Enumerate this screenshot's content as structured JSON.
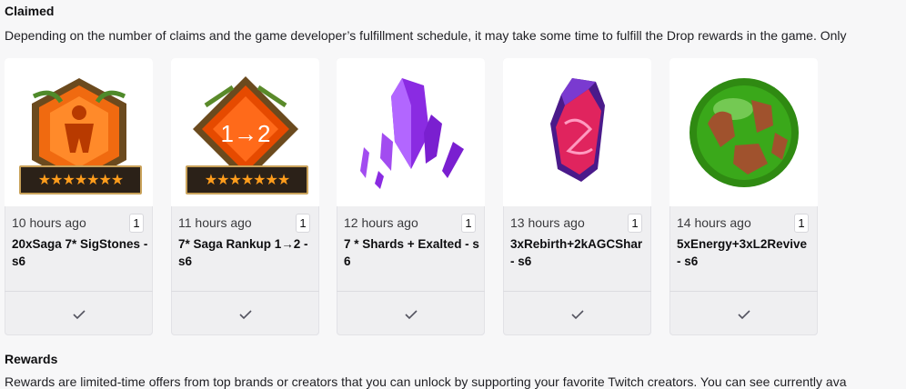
{
  "claimed": {
    "title": "Claimed",
    "description": "Depending on the number of claims and the game developer’s fulfillment schedule, it may take some time to fulfill the Drop rewards in the game. Only"
  },
  "cards": [
    {
      "time": "10 hours ago",
      "count": "1",
      "name": "20xSaga 7* SigStones - s6",
      "icon": "orange-hexagon-sigstone-icon"
    },
    {
      "time": "11 hours ago",
      "count": "1",
      "name": "7* Saga Rankup 1→2 - s6",
      "icon": "orange-diamond-rankup-icon"
    },
    {
      "time": "12 hours ago",
      "count": "1",
      "name": "7 * Shards + Exalted - s6",
      "icon": "purple-crystal-shards-icon"
    },
    {
      "time": "13 hours ago",
      "count": "1",
      "name": "3xRebirth+2kAGCShar - s6",
      "icon": "pink-crystal-rebirth-icon"
    },
    {
      "time": "14 hours ago",
      "count": "1",
      "name": "5xEnergy+3xL2Revive - s6",
      "icon": "green-orb-energy-icon"
    }
  ],
  "rankup_badge": "1→2",
  "stars": "★★★★★★★",
  "rewards": {
    "title": "Rewards",
    "description": "Rewards are limited-time offers from top brands or creators that you can unlock by supporting your favorite Twitch creators. You can see currently ava"
  },
  "colors": {
    "accent_orange": "#f06a10",
    "star": "#ff9d1c",
    "purple": "#8a2be2",
    "green": "#3aa81a"
  }
}
